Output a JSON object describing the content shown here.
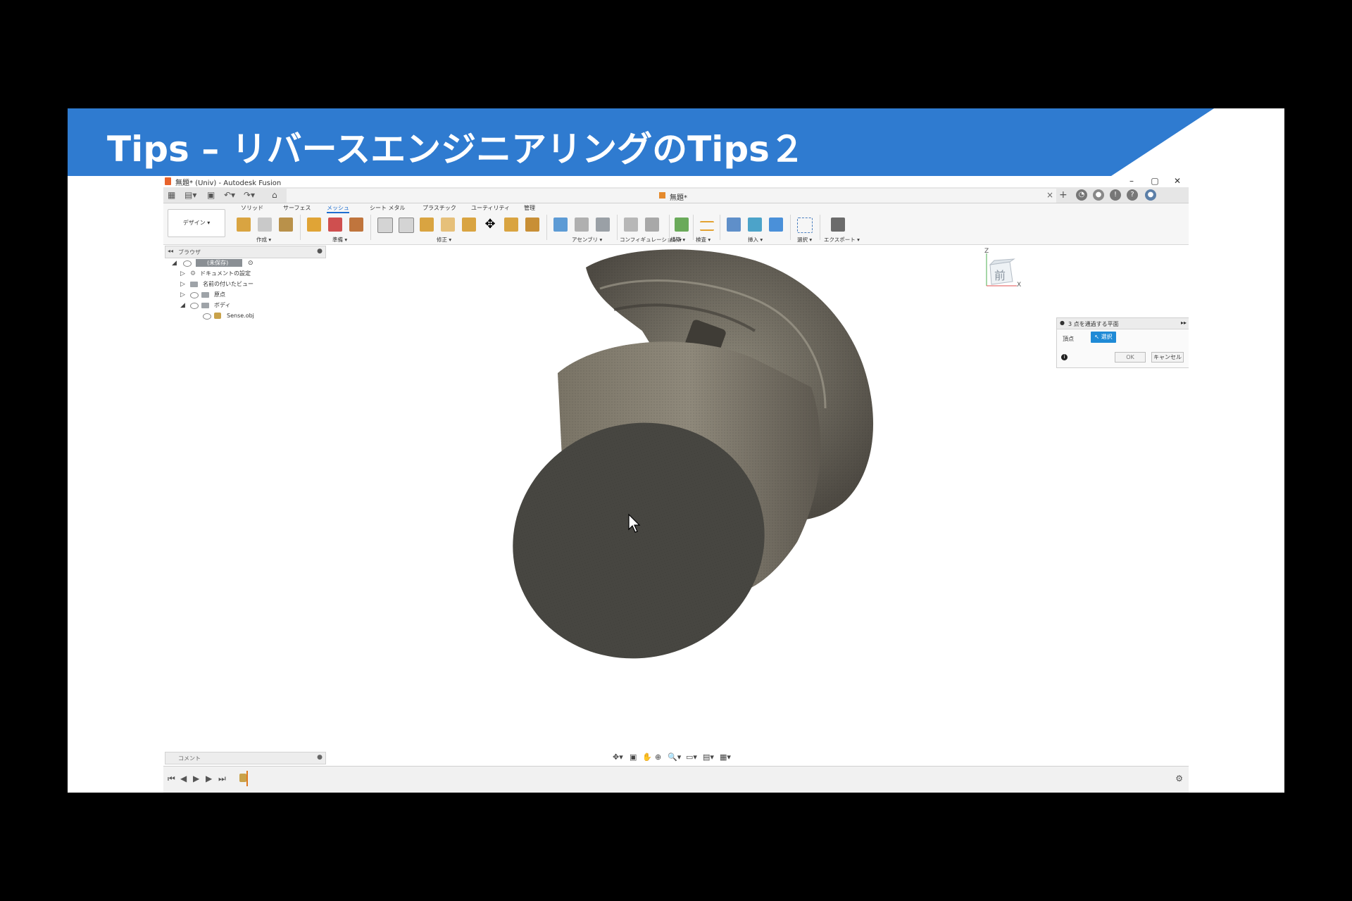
{
  "slide": {
    "title": "Tips – リバースエンジニアリングのTips２",
    "banner_color": "#2f7bd0"
  },
  "app": {
    "window_title": "無題* (Univ) - Autodesk Fusion",
    "window_controls": [
      "–",
      "▢",
      "✕"
    ],
    "document_tab": "無題*",
    "workspace_button": "デザイン ▾",
    "ribbon_tabs": [
      "ソリッド",
      "サーフェス",
      "メッシュ",
      "シート メタル",
      "プラスチック",
      "ユーティリティ",
      "管理"
    ],
    "active_tab": "メッシュ",
    "ribbon_groups": [
      "作成 ▾",
      "準備 ▾",
      "修正 ▾",
      "アセンブリ ▾",
      "コンフィギュレーション ▾",
      "構築 ▾",
      "検査 ▾",
      "挿入 ▾",
      "選択 ▾",
      "エクスポート ▾"
    ],
    "browser": {
      "header": "ブラウザ",
      "root": "(未保存)",
      "nodes": [
        "ドキュメントの設定",
        "名前の付いたビュー",
        "原点",
        "ボディ",
        "Sense.obj"
      ]
    },
    "viewcube": {
      "face": "前",
      "axis_z": "Z",
      "axis_x": "X"
    },
    "command_panel": {
      "title": "3 点を通過する平面",
      "field_label": "頂点",
      "select_button": "選択",
      "ok": "OK",
      "cancel": "キャンセル"
    },
    "comment_label": "コメント",
    "accent_color": "#1f6fd0"
  }
}
